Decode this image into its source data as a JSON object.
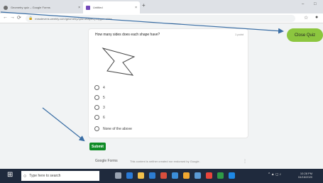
{
  "browser": {
    "tabs": [
      {
        "label": "Geometry quiz – Google Forms",
        "close": "×"
      },
      {
        "label": "Untitled",
        "close": "×"
      }
    ],
    "new_tab": "+",
    "minimize": "–",
    "maximize": "□",
    "back": "←",
    "forward": "→",
    "reload": "⟳",
    "url": "mrsstevens.weebly.com/geometry/quiz-shapes-polygon-sides",
    "star": "☆",
    "profile": "●"
  },
  "question": {
    "text": "How many sides does each shape have?",
    "points": "1 point",
    "options": [
      "4",
      "5",
      "3",
      "6",
      "None of the above"
    ]
  },
  "submit_label": "Submit",
  "close_quiz_label": "Close Quiz",
  "footer": {
    "brand": "Google Forms",
    "disclaimer": "This content is neither created nor endorsed by Google.",
    "menu": "⋮"
  },
  "taskbar": {
    "search_placeholder": "Type here to search",
    "tray_text": "^ ▲ ◻ ♪",
    "time": "10:28 PM",
    "date": "04/16/2020"
  },
  "colors": {
    "submit": "#0f8b25",
    "close_quiz": "#8cc63f",
    "arrow": "#3a6ea5"
  }
}
